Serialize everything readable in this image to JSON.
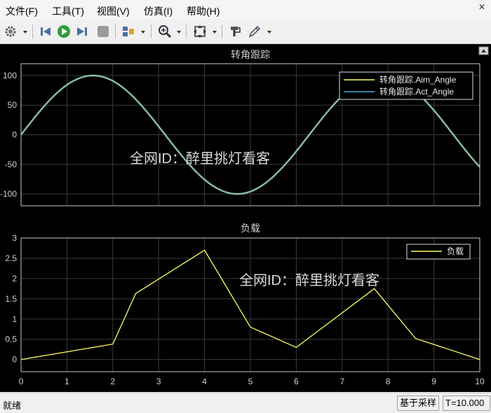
{
  "menu": [
    "文件(F)",
    "工具(T)",
    "视图(V)",
    "仿真(I)",
    "帮助(H)"
  ],
  "toolbar": {
    "icons": [
      "gear-icon",
      "step-back-icon",
      "run-icon",
      "step-forward-icon",
      "stop-icon",
      "layout-icon",
      "zoom-icon",
      "fit-icon",
      "style-icon",
      "edit-icon"
    ],
    "accent": "#2e9e3a"
  },
  "plots": [
    {
      "title": "转角跟踪",
      "watermark": "全网ID：醉里挑灯看客",
      "chart_data": {
        "type": "line",
        "xlim": [
          0,
          10
        ],
        "ylim": [
          -120,
          120
        ],
        "yticks": [
          -100,
          -50,
          0,
          50,
          100
        ],
        "grid": true,
        "legend_position": "top-right",
        "series": [
          {
            "name": "转角跟踪.Aim_Angle",
            "color": "#ffff66",
            "function": "100*sin(t)"
          },
          {
            "name": "转角跟踪.Act_Angle",
            "color": "#4db3e6",
            "function": "100*sin(t)"
          }
        ]
      }
    },
    {
      "title": "负载",
      "watermark": "全网ID：醉里挑灯看客",
      "chart_data": {
        "type": "line",
        "xlim": [
          0,
          10
        ],
        "ylim": [
          -0.3,
          3
        ],
        "yticks": [
          0,
          0.5,
          1,
          1.5,
          2,
          2.5,
          3
        ],
        "xticks": [
          0,
          1,
          2,
          3,
          4,
          5,
          6,
          7,
          8,
          9,
          10
        ],
        "grid": true,
        "legend_position": "top-right",
        "series": [
          {
            "name": "负载",
            "color": "#ffff66",
            "x": [
              0,
              2,
              2.5,
              4,
              5,
              6,
              7.7,
              8.6,
              10
            ],
            "y": [
              0,
              0.38,
              1.63,
              2.7,
              0.8,
              0.3,
              1.75,
              0.52,
              0
            ]
          }
        ]
      }
    }
  ],
  "status": {
    "text": "就绪",
    "mode": "基于采样",
    "time": "T=10.000"
  }
}
